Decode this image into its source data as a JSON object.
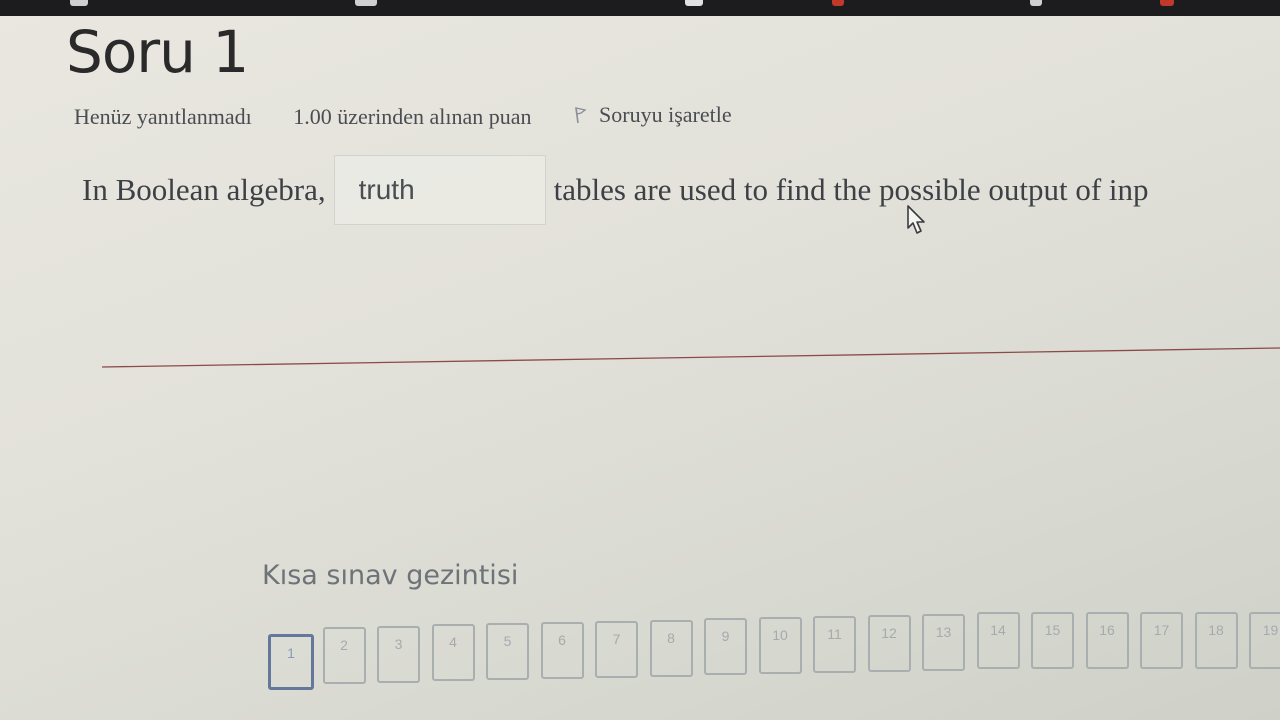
{
  "title": "Soru 1",
  "info": {
    "status": "Henüz yanıtlanmadı",
    "points": "1.00 üzerinden alınan puan",
    "flag_label": "Soruyu işaretle"
  },
  "question": {
    "prefix": "In Boolean algebra,",
    "answer_value": "truth",
    "suffix": "tables are used to find the possible output of inp"
  },
  "navigation": {
    "title": "Kısa sınav gezintisi",
    "buttons": [
      "1",
      "2",
      "3",
      "4",
      "5",
      "6",
      "7",
      "8",
      "9",
      "10",
      "11",
      "12",
      "13",
      "14",
      "15",
      "16",
      "17",
      "18",
      "19"
    ],
    "current": "1"
  },
  "colors": {
    "divider": "#8c4a4a",
    "current_border": "#64789c"
  }
}
